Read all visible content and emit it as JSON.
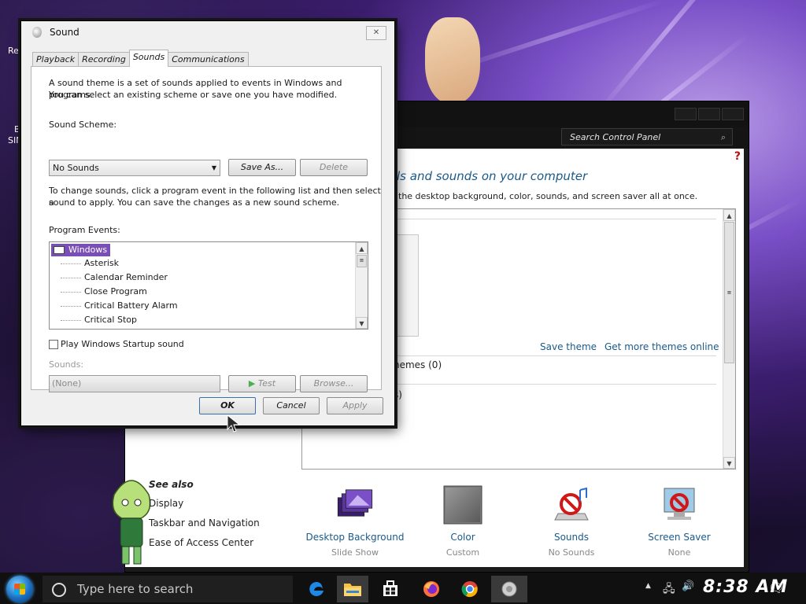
{
  "desktop": {
    "label_top": "Re",
    "label_mid": "B",
    "label_low": "SIM"
  },
  "control_panel": {
    "search_placeholder": "Search Control Panel",
    "help_glyph": "?",
    "title": "ls and sounds on your computer",
    "subtitle": "the desktop background, color, sounds, and screen saver all at once.",
    "save_theme": "Save theme",
    "get_more_themes": "Get more themes online",
    "installed_themes": "hemes (0)",
    "partial_text": "s)",
    "see_also": {
      "heading": "See also",
      "items": [
        "Display",
        "Taskbar and Navigation",
        "Ease of Access Center"
      ]
    },
    "bottom_items": [
      {
        "label": "Desktop Background",
        "sub": "Slide Show"
      },
      {
        "label": "Color",
        "sub": "Custom"
      },
      {
        "label": "Sounds",
        "sub": "No Sounds"
      },
      {
        "label": "Screen Saver",
        "sub": "None"
      }
    ]
  },
  "dialog": {
    "title": "Sound",
    "close_glyph": "✕",
    "tabs": [
      "Playback",
      "Recording",
      "Sounds",
      "Communications"
    ],
    "active_tab": "Sounds",
    "intro_line1": "A sound theme is a set of sounds applied to events in Windows and programs.",
    "intro_line2": "You can select an existing scheme or save one you have modified.",
    "scheme_label": "Sound Scheme:",
    "scheme_value": "No Sounds",
    "save_as": "Save As...",
    "delete": "Delete",
    "change_line1": "To change sounds, click a program event in the following list and then select a",
    "change_line2": "sound to apply.  You can save the changes as a new sound scheme.",
    "events_label": "Program Events:",
    "events_root": "Windows",
    "events": [
      "Asterisk",
      "Calendar Reminder",
      "Close Program",
      "Critical Battery Alarm",
      "Critical Stop"
    ],
    "startup_label": "Play Windows Startup sound",
    "startup_checked": false,
    "sounds_label": "Sounds:",
    "sounds_value": "(None)",
    "test": "Test",
    "browse": "Browse...",
    "ok": "OK",
    "cancel": "Cancel",
    "apply": "Apply"
  },
  "taskbar": {
    "search_placeholder": "Type here to search",
    "clock": "8:38 AM",
    "apps": [
      "edge-icon",
      "file-explorer-icon",
      "store-icon",
      "firefox-icon",
      "chrome-icon",
      "sound-app-icon"
    ]
  },
  "colors": {
    "accent": "#7a4fb5",
    "link": "#1a5a8a",
    "taskbar": "#101010"
  }
}
